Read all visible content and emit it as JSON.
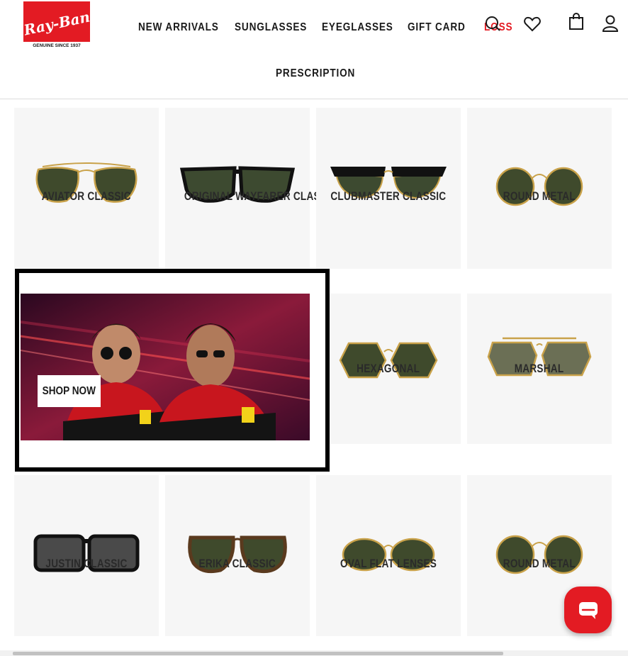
{
  "brand": {
    "logo_text": "Ray-Ban",
    "logo_tagline": "GENUINE SINCE 1937",
    "brand_red": "#e31b23"
  },
  "nav": {
    "items": [
      "NEW ARRIVALS",
      "SUNGLASSES",
      "EYEGLASSES",
      "GIFT CARD",
      "LOSS",
      "PRESCRIPTION"
    ],
    "icons": [
      "search-icon",
      "heart-icon",
      "bag-icon",
      "user-icon"
    ]
  },
  "products": [
    {
      "name": "AVIATOR CLASSIC",
      "style": "aviator"
    },
    {
      "name": "ORIGINAL WAYFARER CLASSIC",
      "style": "wayfarer"
    },
    {
      "name": "CLUBMASTER CLASSIC",
      "style": "clubmaster"
    },
    {
      "name": "ROUND METAL",
      "style": "round"
    },
    {
      "name": "HEXAGONAL",
      "style": "hexagonal"
    },
    {
      "name": "MARSHAL",
      "style": "marshal"
    },
    {
      "name": "JUSTIN CLASSIC",
      "style": "justin"
    },
    {
      "name": "ERIKA CLASSIC",
      "style": "erika"
    },
    {
      "name": "OVAL FLAT LENSES",
      "style": "oval"
    },
    {
      "name": "ROUND METAL",
      "style": "round"
    }
  ],
  "promo": {
    "button_label": "SHOP NOW"
  },
  "chat": {
    "icon": "chat-icon"
  }
}
